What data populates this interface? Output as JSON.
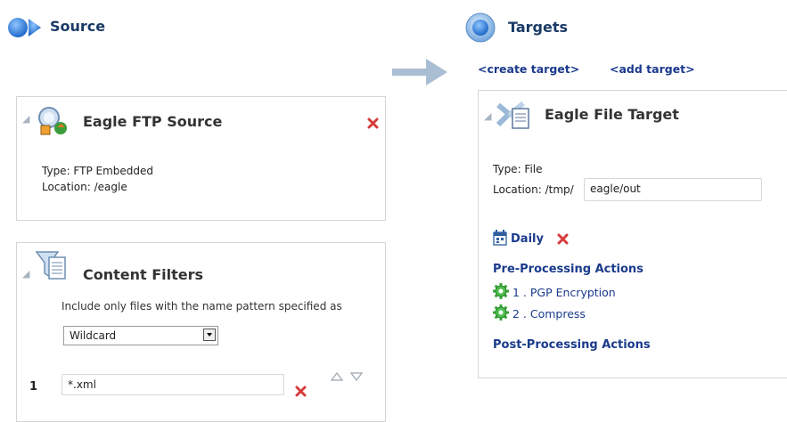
{
  "source": {
    "heading": "Source",
    "ftp_panel": {
      "title": "Eagle FTP Source",
      "type_line": "Type: FTP Embedded",
      "location_line": "Location: /eagle"
    },
    "filters_panel": {
      "title": "Content Filters",
      "description": "Include only files with the name pattern specified as",
      "pattern_type": "Wildcard",
      "rows": [
        {
          "index": "1",
          "pattern": "*.xml"
        }
      ]
    }
  },
  "targets": {
    "heading": "Targets",
    "create_link": "<create target>",
    "add_link": "<add target>",
    "file_panel": {
      "title": "Eagle File Target",
      "type_line": "Type: File",
      "location_label": "Location: /tmp/",
      "location_value": "eagle/out",
      "schedule": "Daily",
      "pre_title": "Pre-Processing Actions",
      "pre_actions": [
        "1 . PGP Encryption",
        "2 . Compress"
      ],
      "post_title": "Post-Processing Actions"
    }
  },
  "colors": {
    "heading": "#1a3a66",
    "link": "#1a3a8c",
    "remove_x": "#d63c3c",
    "arrow": "#a9bdd3",
    "gear": "#3aa53a"
  },
  "icons": {
    "source_heading": "source-arrow-icon",
    "targets_heading": "target-circle-icon",
    "ftp_source": "ftp-source-icon",
    "filter": "funnel-filter-icon",
    "file_target": "file-target-icon",
    "schedule": "calendar-icon",
    "action": "gear-icon",
    "remove": "remove-x-icon"
  }
}
